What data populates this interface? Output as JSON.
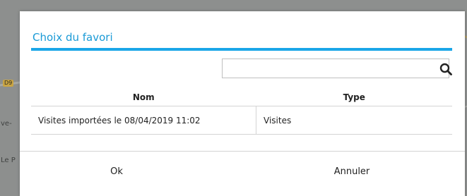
{
  "background": {
    "map_labels": [
      "ve-",
      "Le P"
    ],
    "route_badge": "D9"
  },
  "dialog": {
    "title": "Choix du favori",
    "accent_color": "#1ba6e8",
    "search": {
      "value": "",
      "placeholder": "",
      "icon": "search-icon"
    },
    "table": {
      "headers": {
        "name": "Nom",
        "type": "Type"
      },
      "rows": [
        {
          "name": "Visites importées le 08/04/2019 11:02",
          "type": "Visites"
        }
      ]
    },
    "buttons": {
      "ok": "Ok",
      "cancel": "Annuler"
    }
  }
}
